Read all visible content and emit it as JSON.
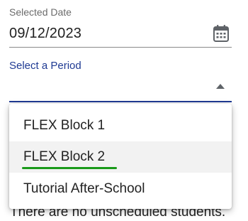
{
  "date_field": {
    "label": "Selected Date",
    "value": "09/12/2023",
    "icon": "calendar-icon"
  },
  "period_field": {
    "label": "Select a Period",
    "selected_value": "",
    "accent_color": "#1f3a93"
  },
  "dropdown": {
    "options": [
      {
        "label": "FLEX Block 1"
      },
      {
        "label": "FLEX Block 2"
      },
      {
        "label": "Tutorial After-School"
      }
    ],
    "hovered_option": "FLEX Block 2",
    "highlight_color": "#1a9a1a"
  },
  "status_message": "There are no unscheduled students."
}
